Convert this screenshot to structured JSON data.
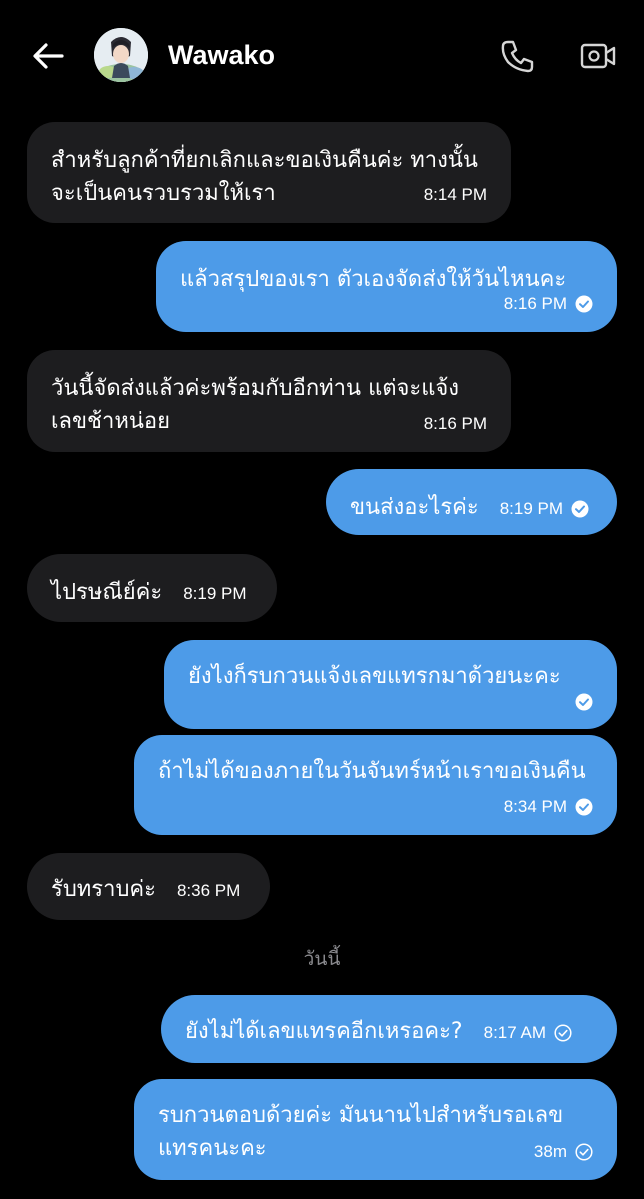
{
  "header": {
    "contact_name": "Wawako"
  },
  "messages": [
    {
      "dir": "in",
      "text": "สำหรับลูกค้าที่ยกเลิกและขอเงินคืนค่ะ ทางนั้นจะเป็นคนรวบรวมให้เรา",
      "time": "8:14 PM"
    },
    {
      "dir": "out",
      "text": "แล้วสรุปของเรา ตัวเองจัดส่งให้วันไหนคะ",
      "time": "8:16 PM",
      "status": "read"
    },
    {
      "dir": "in",
      "text": "วันนี้จัดส่งแล้วค่ะพร้อมกับอีกท่าน แต่จะแจ้งเลขช้าหน่อย",
      "time": "8:16 PM"
    },
    {
      "dir": "out",
      "text": "ขนส่งอะไรค่ะ",
      "time": "8:19 PM",
      "status": "read"
    },
    {
      "dir": "in",
      "text": "ไปรษณีย์ค่ะ",
      "time": "8:19 PM"
    },
    {
      "dir": "out",
      "text": "ยังไงก็รบกวนแจ้งเลขแทรกมาด้วยนะคะ",
      "time": "",
      "status": "read"
    },
    {
      "dir": "out",
      "text": "ถ้าไม่ได้ของภายในวันจันทร์หน้าเราขอเงินคืน",
      "time": "8:34 PM",
      "status": "read"
    },
    {
      "dir": "in",
      "text": "รับทราบค่ะ",
      "time": "8:36 PM"
    },
    {
      "dir": "out",
      "text": "ยังไม่ได้เลขแทรคอีกเหรอคะ?",
      "time": "8:17 AM",
      "status": "sent"
    },
    {
      "dir": "out",
      "text": "รบกวนตอบด้วยค่ะ มันนานไปสำหรับรอเลขแทรคนะคะ",
      "time": "38m",
      "status": "sent"
    }
  ],
  "date_separator": "วันนี้",
  "colors": {
    "background": "#000000",
    "incoming_bubble": "#1d1d1f",
    "outgoing_bubble": "#4d9be8",
    "text": "#ffffff",
    "separator_text": "#8a8a8e"
  },
  "icons": {
    "back": "arrow-left-icon",
    "call": "phone-icon",
    "video": "video-camera-icon",
    "read": "check-circle-filled-icon",
    "sent": "check-circle-outline-icon"
  }
}
